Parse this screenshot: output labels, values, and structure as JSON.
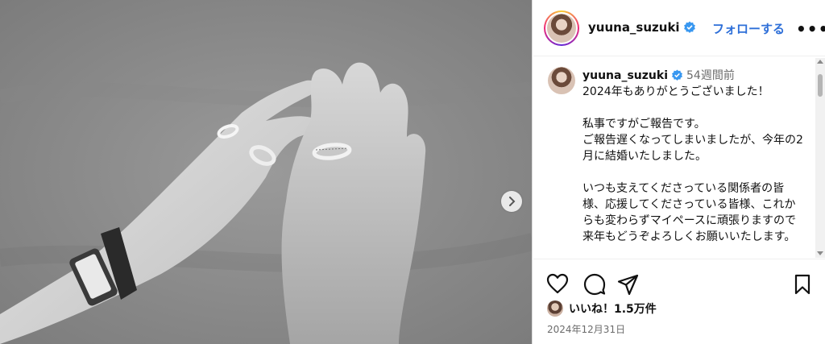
{
  "header": {
    "username": "yuuna_suzuki",
    "follow_label": "フォローする",
    "more_label": "•••"
  },
  "caption": {
    "username": "yuuna_suzuki",
    "time": "54週間前",
    "text": "2024年もありがとうございました！\n\n私事ですがご報告です。\nご報告遅くなってしまいましたが、今年の2月に結婚いたしました。\n\nいつも支えてくださっている関係者の皆様、応援してくださっている皆様、これからも変わらずマイペースに頑張りますので来年もどうぞよろしくお願いいたします。"
  },
  "likes": {
    "text": "いいね！1.5万件"
  },
  "post_date": "2024年12月31日",
  "icons": [
    "verified-badge-icon",
    "heart-icon",
    "comment-icon",
    "share-icon",
    "bookmark-icon",
    "chevron-right-icon"
  ],
  "colors": {
    "follow": "#2e6fd8",
    "verified": "#3897f0",
    "muted": "#6c6c6c"
  }
}
